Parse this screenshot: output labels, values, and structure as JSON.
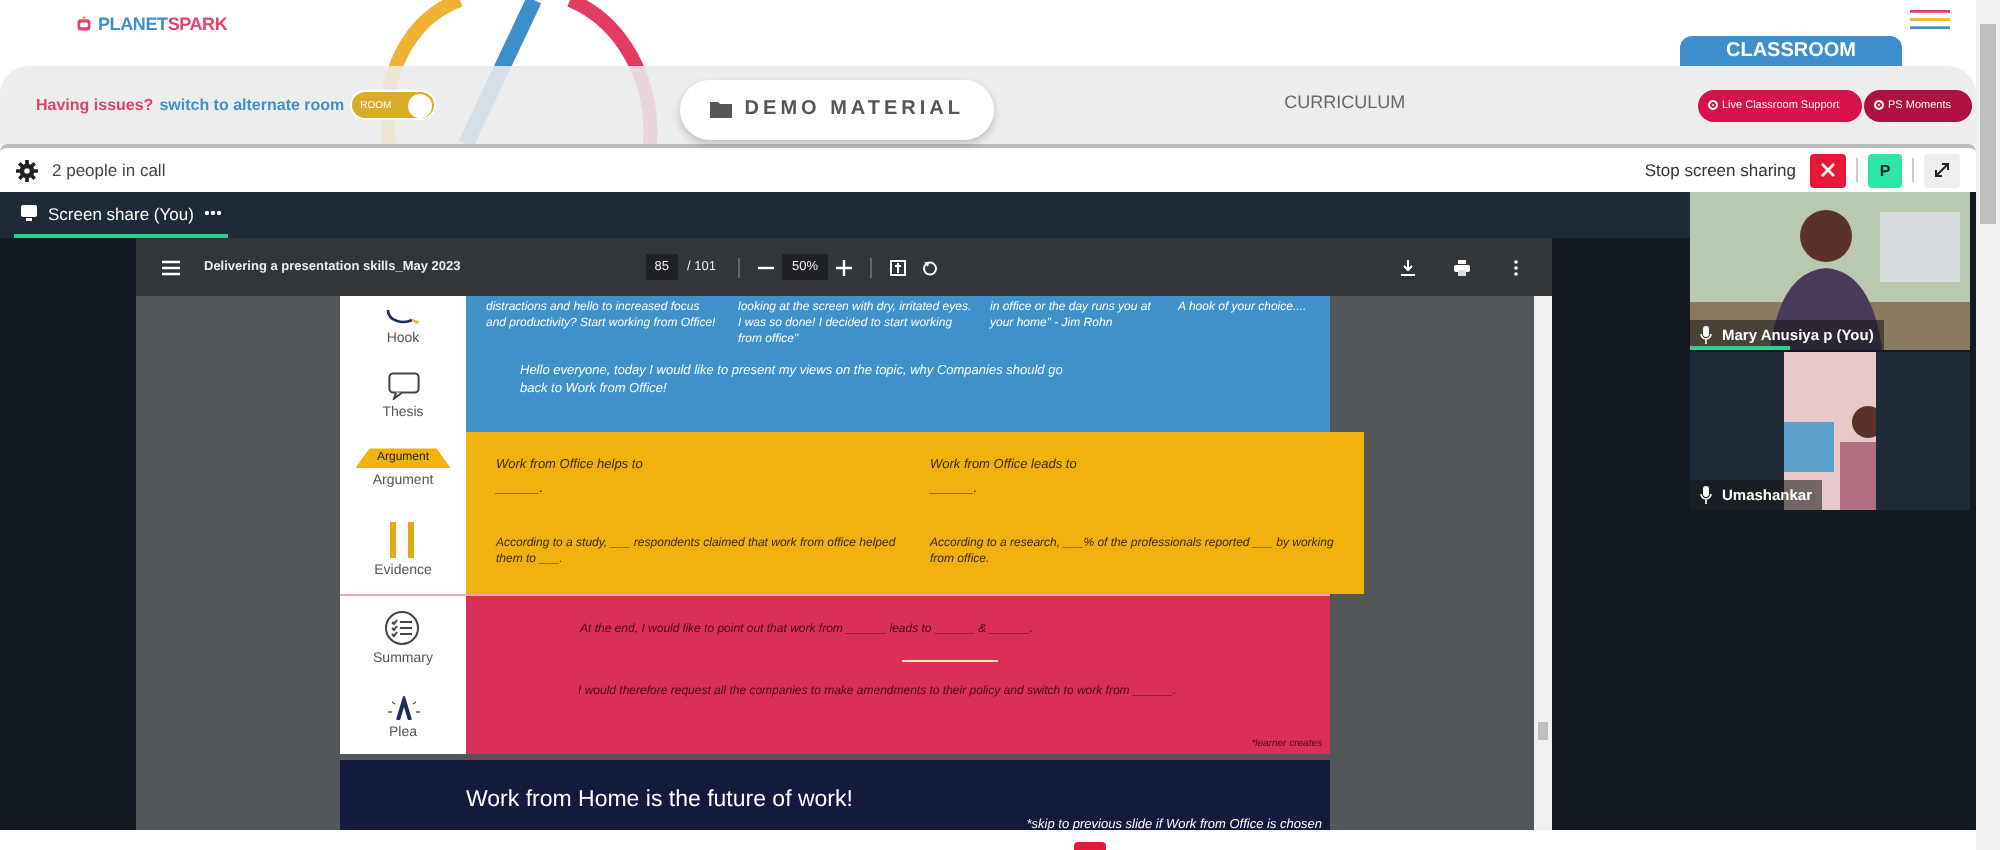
{
  "header": {
    "logo": [
      "PLANET",
      "SPARK"
    ],
    "classroom_tab": "CLASSROOM"
  },
  "room_bar": {
    "issue_text": "Having issues?",
    "switch_link": "switch to alternate room",
    "room_toggle": {
      "label": "ROOM",
      "on": true
    },
    "demo_button": "DEMO MATERIAL",
    "curriculum": "CURRICULUM",
    "pills": [
      "Live Classroom Support",
      "PS Moments"
    ]
  },
  "call_bar": {
    "people": "2 people in call",
    "stop_label": "Stop screen sharing",
    "avatar_letter": "P"
  },
  "share_tab": {
    "label": "Screen share (You)",
    "selected": true
  },
  "pdf": {
    "title": "Delivering a presentation skills_May 2023",
    "page": "85",
    "pages": "/ 101",
    "zoom": "50%"
  },
  "slide": {
    "hook_texts": [
      "distractions and hello to increased focus and productivity? Start working from Office!",
      "looking at the screen with dry, irritated eyes. I was so done! I decided to start working from office\"",
      "in office or the day runs you at your home\" - Jim Rohn",
      "A hook of your choice...."
    ],
    "thesis": "Hello everyone, today I would like to present my views on the topic, why Companies should go back to Work from Office!",
    "arguments": [
      {
        "text": "Work from Office helps to",
        "blank": "______."
      },
      {
        "text": "Work from Office leads to",
        "blank": "______."
      }
    ],
    "evidence": [
      "According to a study, ___ respondents claimed that work from office helped them to ___.",
      "According to a research, ___% of the professionals reported ___ by working from office."
    ],
    "summary": "At the end, I would like to point out that work from ______ leads to ______ & ______.",
    "plea": "I would therefore request all the companies to make amendments to their policy and switch to work from ______.",
    "note": "*learner creates",
    "labels": [
      "Hook",
      "Thesis",
      "Argument",
      "Evidence",
      "Summary",
      "Plea"
    ],
    "argument_badge": "Argument"
  },
  "next_slide": {
    "title": "Work from Home is the future of work!",
    "note": "*skip to previous slide if Work from Office is chosen"
  },
  "participants": [
    {
      "name": "Mary Anusiya p (You)",
      "speaking": true
    },
    {
      "name": "Umashankar",
      "speaking": false
    }
  ]
}
